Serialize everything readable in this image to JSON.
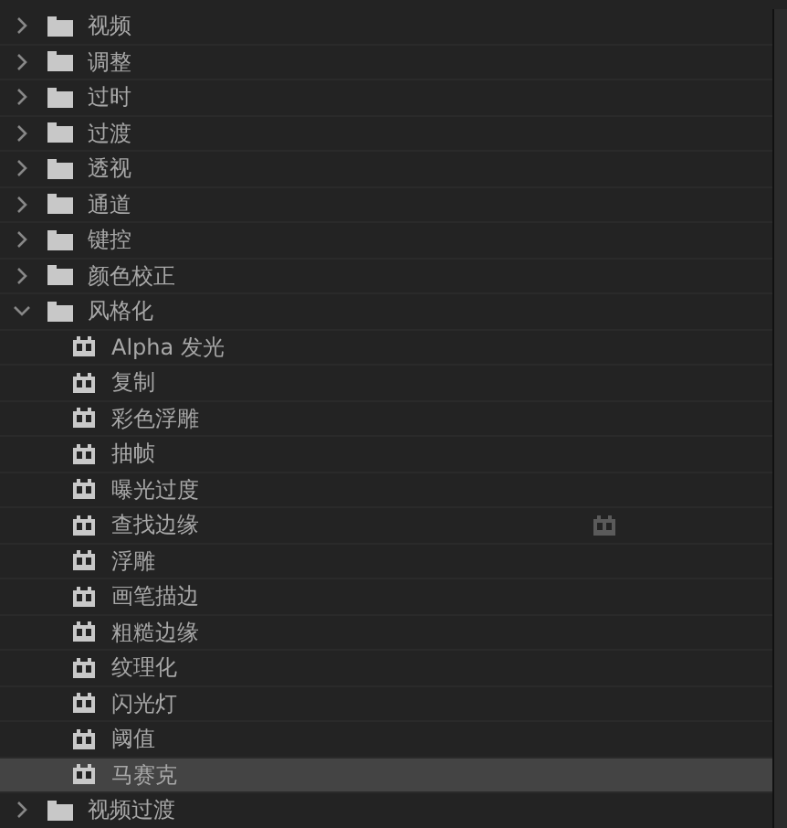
{
  "tree": [
    {
      "label": "视频",
      "expanded": false
    },
    {
      "label": "调整",
      "expanded": false
    },
    {
      "label": "过时",
      "expanded": false
    },
    {
      "label": "过渡",
      "expanded": false
    },
    {
      "label": "透视",
      "expanded": false
    },
    {
      "label": "通道",
      "expanded": false
    },
    {
      "label": "键控",
      "expanded": false
    },
    {
      "label": "颜色校正",
      "expanded": false
    },
    {
      "label": "风格化",
      "expanded": true,
      "children": [
        {
          "label": "Alpha 发光",
          "selected": false,
          "accelerated": false
        },
        {
          "label": "复制",
          "selected": false,
          "accelerated": false
        },
        {
          "label": "彩色浮雕",
          "selected": false,
          "accelerated": false
        },
        {
          "label": "抽帧",
          "selected": false,
          "accelerated": false
        },
        {
          "label": "曝光过度",
          "selected": false,
          "accelerated": false
        },
        {
          "label": "查找边缘",
          "selected": false,
          "accelerated": true
        },
        {
          "label": "浮雕",
          "selected": false,
          "accelerated": false
        },
        {
          "label": "画笔描边",
          "selected": false,
          "accelerated": false
        },
        {
          "label": "粗糙边缘",
          "selected": false,
          "accelerated": false
        },
        {
          "label": "纹理化",
          "selected": false,
          "accelerated": false
        },
        {
          "label": "闪光灯",
          "selected": false,
          "accelerated": false
        },
        {
          "label": "阈值",
          "selected": false,
          "accelerated": false
        },
        {
          "label": "马赛克",
          "selected": true,
          "accelerated": false
        }
      ]
    },
    {
      "label": "视频过渡",
      "expanded": false
    }
  ]
}
